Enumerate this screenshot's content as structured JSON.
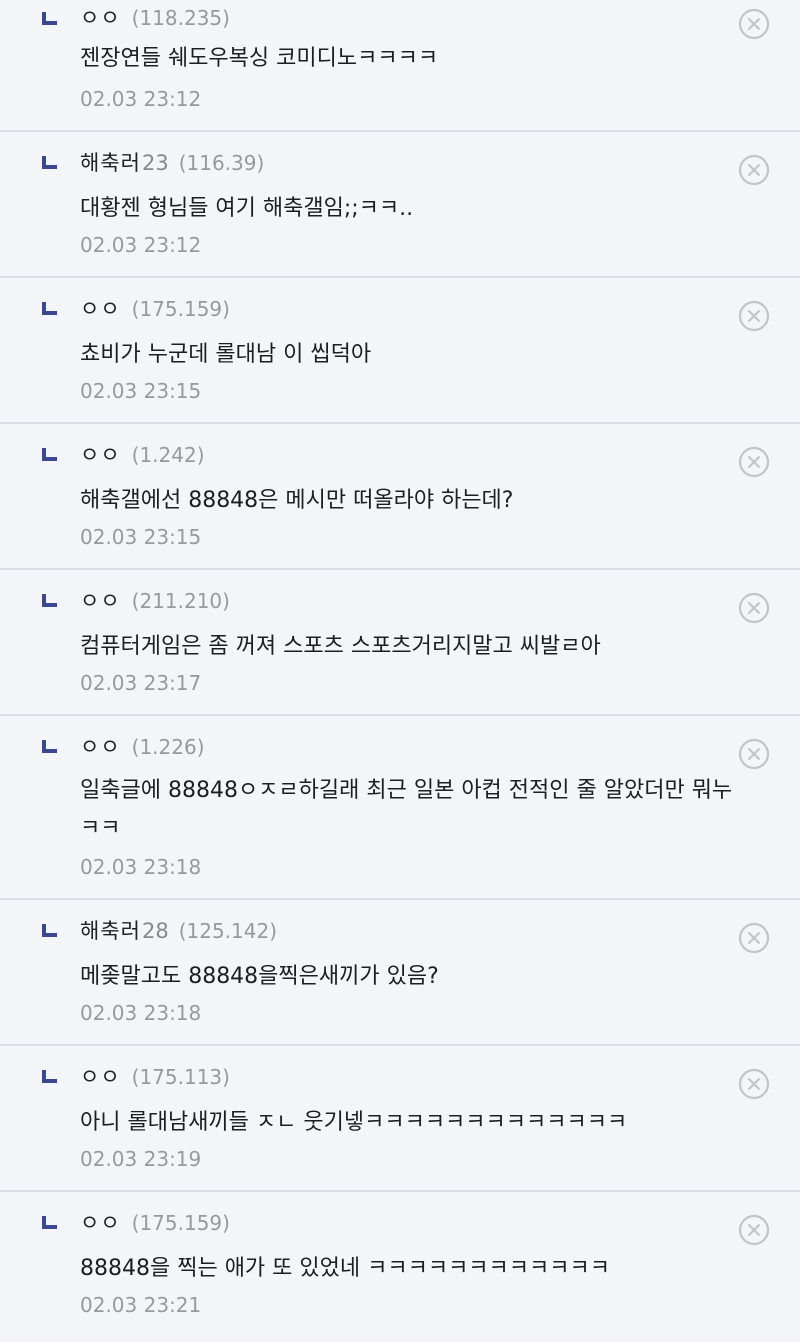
{
  "comments": [
    {
      "nick": "ㅇㅇ",
      "nick_num": "",
      "ip": "(118.235)",
      "text": "젠장연들 쉐도우복싱 코미디노ㅋㅋㅋㅋ",
      "date": "02.03 23:12"
    },
    {
      "nick": "해축러",
      "nick_num": "23",
      "ip": "(116.39)",
      "text": "대황젠 형님들 여기 해축갤임;;ㅋㅋ..",
      "date": "02.03 23:12"
    },
    {
      "nick": "ㅇㅇ",
      "nick_num": "",
      "ip": "(175.159)",
      "text": "쵸비가 누군데 롤대남 이 씹덕아",
      "date": "02.03 23:15"
    },
    {
      "nick": "ㅇㅇ",
      "nick_num": "",
      "ip": "(1.242)",
      "text": "해축갤에선 88848은 메시만 떠올라야 하는데?",
      "date": "02.03 23:15"
    },
    {
      "nick": "ㅇㅇ",
      "nick_num": "",
      "ip": "(211.210)",
      "text": "컴퓨터게임은 좀 꺼져 스포츠 스포츠거리지말고 씨발ㄹ아",
      "date": "02.03 23:17"
    },
    {
      "nick": "ㅇㅇ",
      "nick_num": "",
      "ip": "(1.226)",
      "text": "일축글에 88848ㅇㅈㄹ하길래 최근 일본 아컵 전적인 줄 알았더만 뭐누 ㅋㅋ",
      "date": "02.03 23:18"
    },
    {
      "nick": "해축러",
      "nick_num": "28",
      "ip": "(125.142)",
      "text": "메좆말고도 88848을찍은새끼가 있음?",
      "date": "02.03 23:18"
    },
    {
      "nick": "ㅇㅇ",
      "nick_num": "",
      "ip": "(175.113)",
      "text": "아니 롤대남새끼들 ㅈㄴ 웃기넿ㅋㅋㅋㅋㅋㅋㅋㅋㅋㅋㅋㅋㅋ",
      "date": "02.03 23:19"
    },
    {
      "nick": "ㅇㅇ",
      "nick_num": "",
      "ip": "(175.159)",
      "text": "88848을 찍는 애가 또 있었네 ㅋㅋㅋㅋㅋㅋㅋㅋㅋㅋㅋㅋ",
      "date": "02.03 23:21"
    }
  ],
  "icons": {
    "reply": "reply-arrow-icon",
    "delete": "delete-circle-x-icon"
  },
  "colors": {
    "background": "#f4f5f9",
    "divider": "#dcdde6",
    "reply_mark": "#3b4890",
    "muted_text": "#999999",
    "delete_icon": "#c4c4c4"
  }
}
